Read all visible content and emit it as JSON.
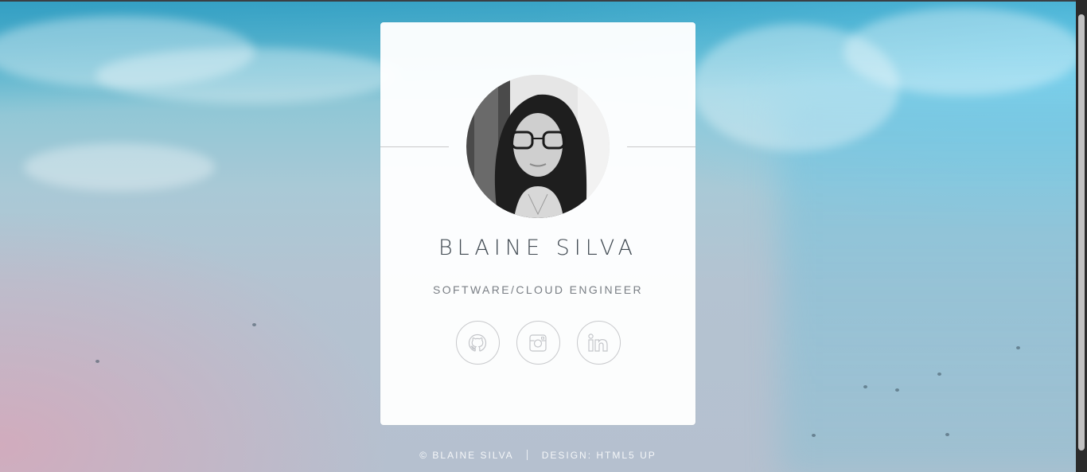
{
  "profile": {
    "name": "BLAINE SILVA",
    "role": "SOFTWARE/CLOUD ENGINEER",
    "avatar_alt": "Portrait of Blaine Silva"
  },
  "socials": [
    {
      "name": "github",
      "icon": "github-icon"
    },
    {
      "name": "instagram",
      "icon": "instagram-icon"
    },
    {
      "name": "linkedin",
      "icon": "linkedin-icon"
    }
  ],
  "footer": {
    "copyright": "© BLAINE SILVA",
    "design": "DESIGN: HTML5 UP"
  },
  "colors": {
    "card": "#ffffff",
    "text_dark": "#414a52",
    "text_muted": "#7a7f85",
    "icon_stroke": "#c8c9cc"
  }
}
